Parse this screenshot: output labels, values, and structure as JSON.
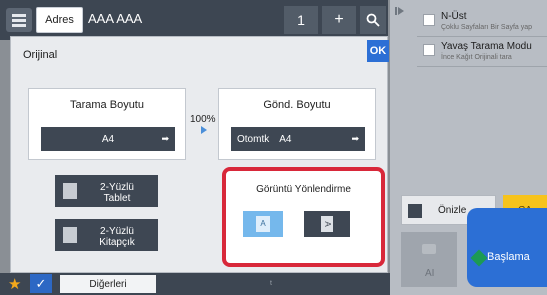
{
  "topbar": {
    "adres_label": "Adres",
    "address_text": "AAA AAA",
    "copies": "1",
    "plus": "+"
  },
  "options": [
    {
      "title": "N-Üst",
      "subtitle": "Çoklu Sayfaları Bir Sayfa yap"
    },
    {
      "title": "Yavaş Tarama Modu",
      "subtitle": "İnce Kağıt Orijinali tara"
    }
  ],
  "dialog": {
    "title": "Orijinal",
    "ok_label": "OK",
    "scan_size": {
      "label": "Tarama Boyutu",
      "value": "A4"
    },
    "ratio": "100%",
    "send_size": {
      "label": "Gönd. Boyutu",
      "auto": "Otomtk",
      "value": "A4"
    },
    "duplex_tablet": "2-Yüzlü\nTablet",
    "duplex_booklet": "2-Yüzlü\nKitapçık",
    "orientation": {
      "label": "Görüntü Yönlendirme",
      "opt_a": "A",
      "opt_b": "A"
    }
  },
  "bottombar": {
    "more_label": "Diğerleri",
    "dot": "t"
  },
  "actions": {
    "preview_label": "Önizle",
    "ca_label": "CA",
    "ai_label": "AI",
    "start_label": "Başlama"
  },
  "colors": {
    "accent_blue": "#2c6fd5",
    "highlight_red": "#d8283a",
    "ca_yellow": "#f6c31c"
  }
}
